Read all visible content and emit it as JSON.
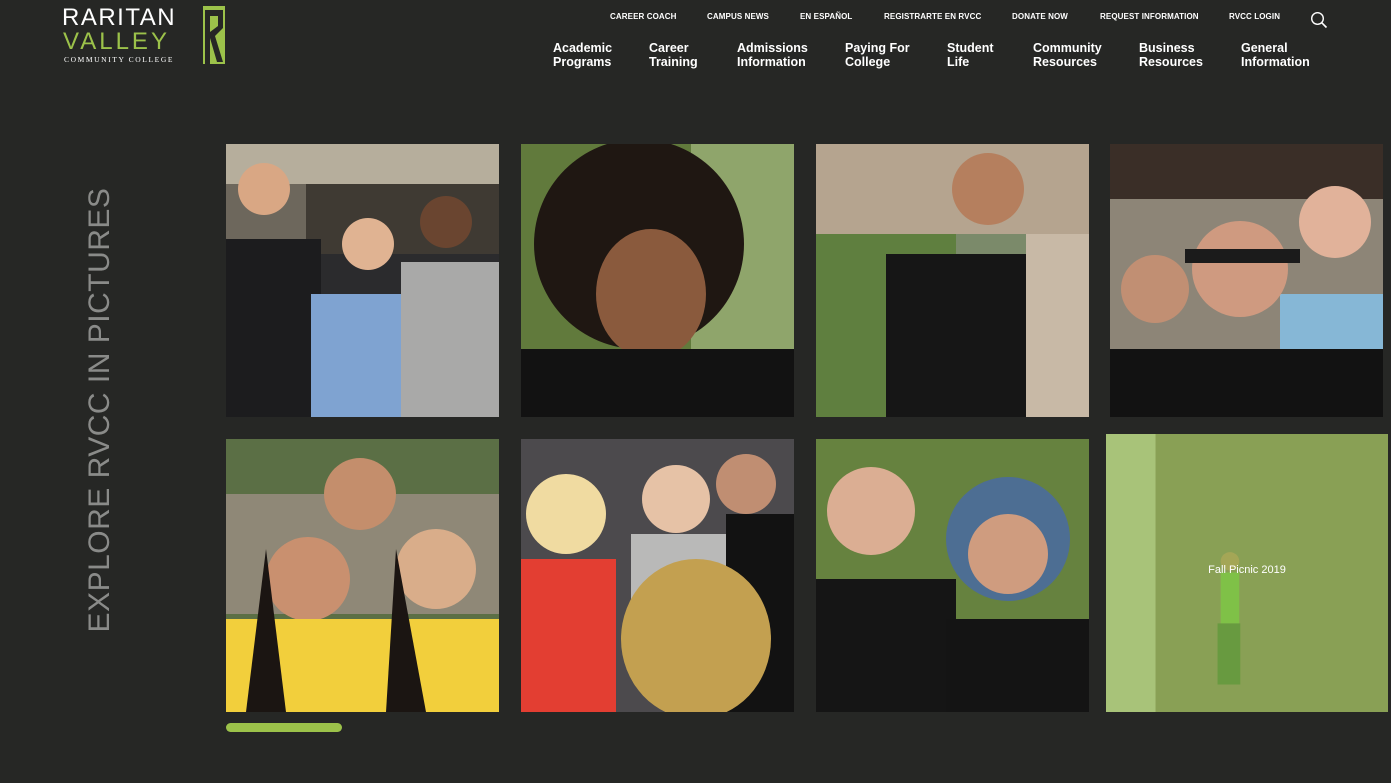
{
  "logo": {
    "line1": "RARITAN",
    "line2": "VALLEY",
    "line3": "COMMUNITY COLLEGE",
    "brand_green": "#9cc24a",
    "mark_icon": "rvcc-r-mark-icon"
  },
  "utility_nav": [
    {
      "label": "CAREER COACH"
    },
    {
      "label": "CAMPUS NEWS"
    },
    {
      "label": "EN ESPAÑOL"
    },
    {
      "label": "REGISTRARTE EN RVCC"
    },
    {
      "label": "DONATE NOW"
    },
    {
      "label": "REQUEST INFORMATION"
    },
    {
      "label": "RVCC LOGIN"
    }
  ],
  "search": {
    "icon": "search-icon"
  },
  "main_nav": [
    {
      "line1": "Academic",
      "line2": "Programs"
    },
    {
      "line1": "Career",
      "line2": "Training"
    },
    {
      "line1": "Admissions",
      "line2": "Information"
    },
    {
      "line1": "Paying For",
      "line2": "College"
    },
    {
      "line1": "Student",
      "line2": "Life"
    },
    {
      "line1": "Community",
      "line2": "Resources"
    },
    {
      "line1": "Business",
      "line2": "Resources"
    },
    {
      "line1": "General",
      "line2": "Information"
    }
  ],
  "gallery": {
    "heading": "EXPLORE RVCC IN PICTURES",
    "hover_caption": "Fall Picnic 2019",
    "scroll_progress": 0.1,
    "colors": {
      "background": "#262725",
      "accent": "#9cc24a",
      "heading": "#8a8b89"
    }
  }
}
